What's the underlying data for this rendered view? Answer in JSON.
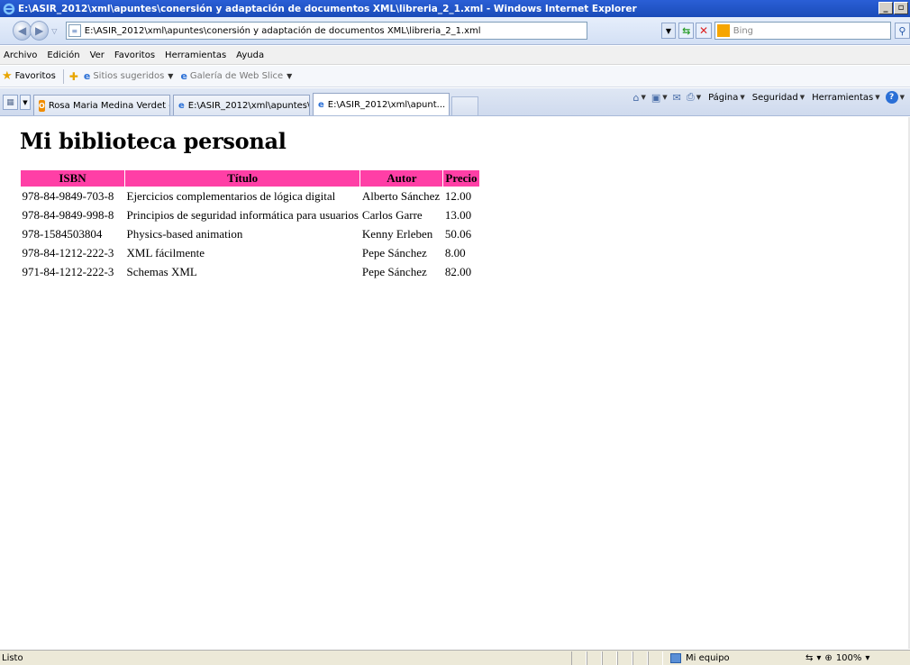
{
  "window": {
    "title": "E:\\ASIR_2012\\xml\\apuntes\\conersión y adaptación de documentos XML\\libreria_2_1.xml - Windows Internet Explorer",
    "minimize": "_",
    "maximize": "▫"
  },
  "address": {
    "url": "E:\\ASIR_2012\\xml\\apuntes\\conersión y adaptación de documentos XML\\libreria_2_1.xml",
    "search_placeholder": "Bing"
  },
  "menu": [
    "Archivo",
    "Edición",
    "Ver",
    "Favoritos",
    "Herramientas",
    "Ayuda"
  ],
  "favorites": {
    "label": "Favoritos",
    "links": [
      "Sitios sugeridos",
      "Galería de Web Slice"
    ]
  },
  "tabs": [
    {
      "label": "Rosa Maria Medina Verdet - ...",
      "icon": "o-icon"
    },
    {
      "label": "E:\\ASIR_2012\\xml\\apuntes\\...",
      "icon": "ie-icon"
    },
    {
      "label": "E:\\ASIR_2012\\xml\\apunt...",
      "icon": "ie-icon"
    }
  ],
  "commands": {
    "pagina": "Página",
    "seguridad": "Seguridad",
    "herramientas": "Herramientas"
  },
  "page": {
    "title": "Mi biblioteca personal",
    "headers": [
      "ISBN",
      "Título",
      "Autor",
      "Precio"
    ],
    "rows": [
      [
        "978-84-9849-703-8",
        "Ejercicios complementarios de lógica digital",
        "Alberto Sánchez",
        "12.00"
      ],
      [
        "978-84-9849-998-8",
        "Principios de seguridad informática para usuarios",
        "Carlos Garre",
        "13.00"
      ],
      [
        "978-1584503804",
        "Physics-based animation",
        "Kenny Erleben",
        "50.06"
      ],
      [
        "978-84-1212-222-3",
        "XML fácilmente",
        "Pepe Sánchez",
        "8.00"
      ],
      [
        "971-84-1212-222-3",
        "Schemas XML",
        "Pepe Sánchez",
        "82.00"
      ]
    ],
    "header_color": "#ff3fa6"
  },
  "status": {
    "text": "Listo",
    "zone": "Mi equipo",
    "zoom": "100%"
  }
}
